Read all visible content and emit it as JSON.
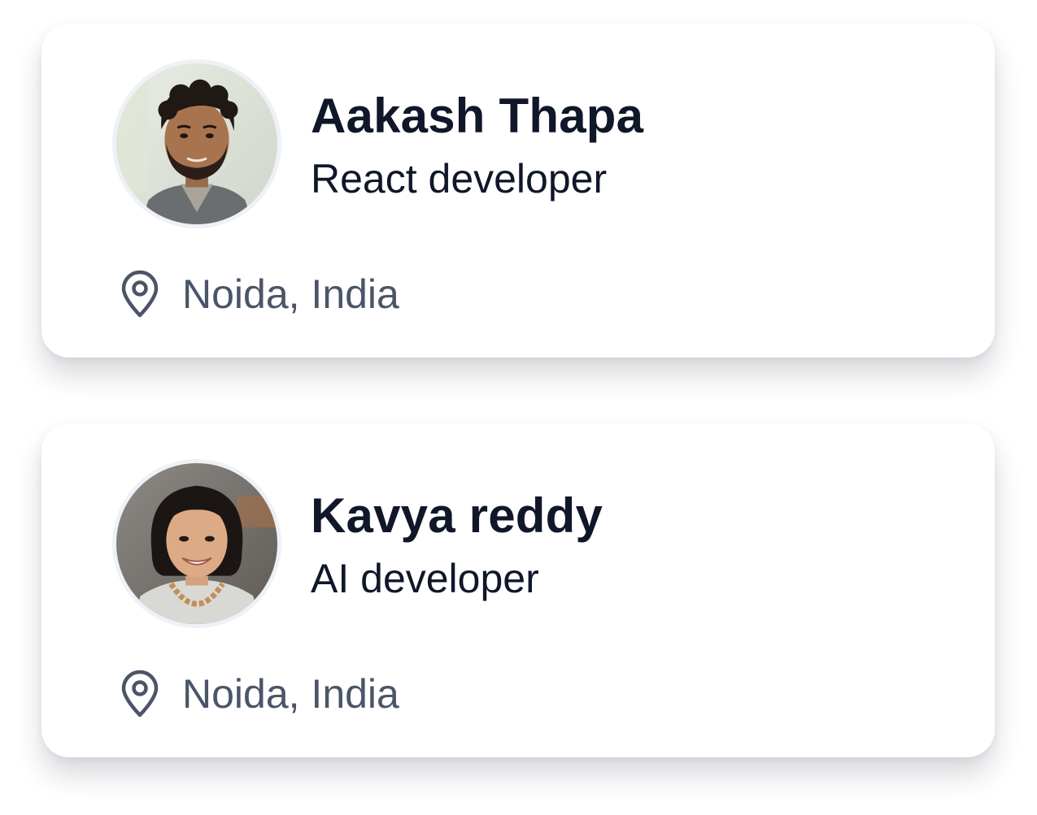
{
  "cards": [
    {
      "name": "Aakash Thapa",
      "role": "React developer",
      "location": "Noida, India",
      "avatar_icon": "avatar-photo-man",
      "location_icon": "map-pin-icon"
    },
    {
      "name": "Kavya reddy",
      "role": "AI developer",
      "location": "Noida, India",
      "avatar_icon": "avatar-photo-woman",
      "location_icon": "map-pin-icon"
    }
  ],
  "colors": {
    "name_text": "#0f1729",
    "role_text": "#0f1729",
    "location_text": "#4b5567",
    "icon_stroke": "#4b5567",
    "card_background": "#ffffff",
    "avatar_ring": "#eef1f6"
  }
}
